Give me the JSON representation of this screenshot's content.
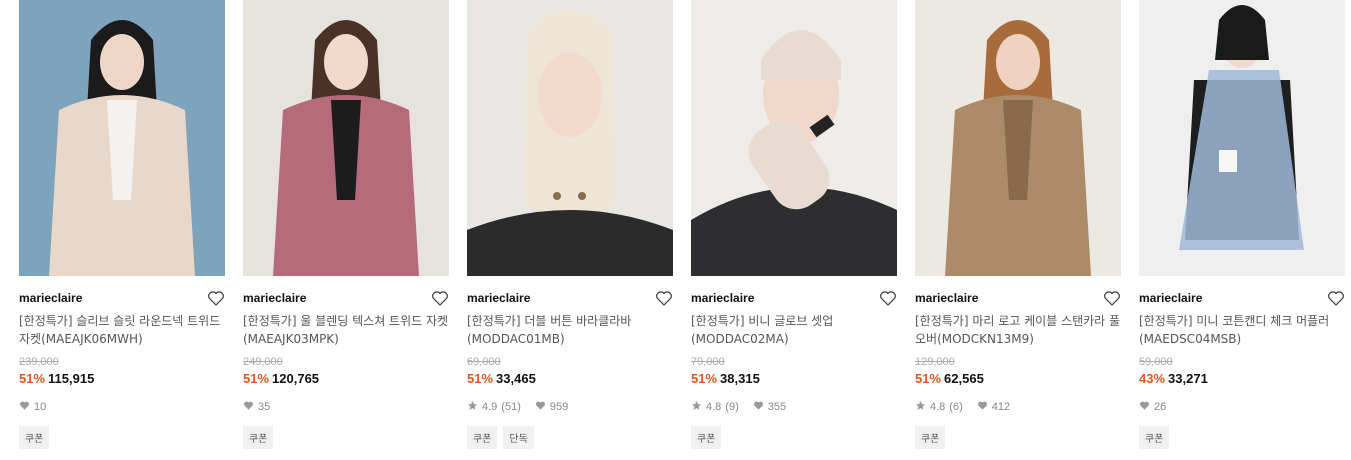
{
  "colors": {
    "discount": "#e8561c",
    "original_price": "#aaaaaa"
  },
  "products": [
    {
      "brand": "marieclaire",
      "title": "[한정특가] 슬리브 슬릿 라운드넥 트위드 자켓(MAEAJK06MWH)",
      "original_price": "239,000",
      "discount": "51%",
      "price": "115,915",
      "rating": "",
      "reviews": "",
      "likes": "10",
      "tags": [
        "쿠폰"
      ],
      "image_alt": "tweed jacket model"
    },
    {
      "brand": "marieclaire",
      "title": "[한정특가] 울 블렌딩 텍스쳐 트위드 자켓(MAEAJK03MPK)",
      "original_price": "249,000",
      "discount": "51%",
      "price": "120,765",
      "rating": "",
      "reviews": "",
      "likes": "35",
      "tags": [
        "쿠폰"
      ],
      "image_alt": "pink tweed jacket model"
    },
    {
      "brand": "marieclaire",
      "title": "[한정특가] 더블 버튼 바라클라바(MODDAC01MB)",
      "original_price": "69,000",
      "discount": "51%",
      "price": "33,465",
      "rating": "4.9",
      "reviews": "(51)",
      "likes": "959",
      "tags": [
        "쿠폰",
        "단독"
      ],
      "image_alt": "knit balaclava model"
    },
    {
      "brand": "marieclaire",
      "title": "[한정특가] 비니 글로브 셋업(MODDAC02MA)",
      "original_price": "79,000",
      "discount": "51%",
      "price": "38,315",
      "rating": "4.8",
      "reviews": "(9)",
      "likes": "355",
      "tags": [
        "쿠폰"
      ],
      "image_alt": "beanie and gloves model"
    },
    {
      "brand": "marieclaire",
      "title": "[한정특가] 마리 로고 케이블 스탠카라 풀오버(MODCKN13M9)",
      "original_price": "129,000",
      "discount": "51%",
      "price": "62,565",
      "rating": "4.8",
      "reviews": "(6)",
      "likes": "412",
      "tags": [
        "쿠폰"
      ],
      "image_alt": "cable knit pullover model"
    },
    {
      "brand": "marieclaire",
      "title": "[한정특가] 미니 코튼캔디 체크 머플러(MAEDSC04MSB)",
      "original_price": "59,000",
      "discount": "43%",
      "price": "33,271",
      "rating": "",
      "reviews": "",
      "likes": "26",
      "tags": [
        "쿠폰"
      ],
      "image_alt": "check muffler model"
    }
  ]
}
